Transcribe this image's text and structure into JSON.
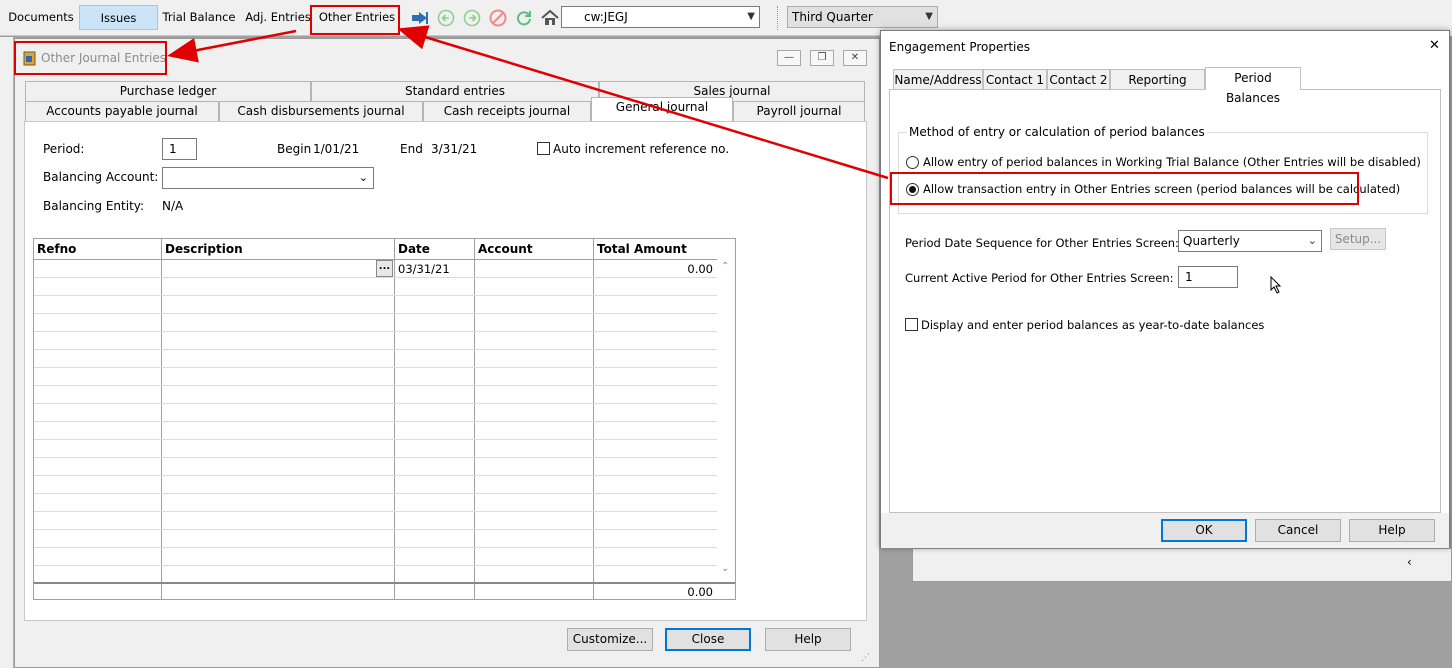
{
  "toolbar": {
    "items": [
      "Documents",
      "Issues",
      "Trial Balance",
      "Adj. Entries",
      "Other Entries"
    ],
    "document_combo": "cw:JEGJ",
    "period_combo": "Third Quarter",
    "colors": {
      "active_tab": "#cce4f7",
      "annotation": "#e00000"
    }
  },
  "oje": {
    "title": "Other Journal Entries",
    "tabs_row1": [
      "Purchase ledger",
      "Standard entries",
      "Sales journal"
    ],
    "tabs_row2": [
      "Accounts payable journal",
      "Cash disbursements journal",
      "Cash receipts journal",
      "General journal",
      "Payroll journal"
    ],
    "period_label": "Period:",
    "period_value": "1",
    "begin_label": "Begin",
    "begin_value": "1/01/21",
    "end_label": "End",
    "end_value": "3/31/21",
    "auto_increment_label": "Auto increment reference no.",
    "balancing_account_label": "Balancing Account:",
    "balancing_entity_label": "Balancing Entity:",
    "balancing_entity_value": "N/A",
    "grid": {
      "columns": [
        "Refno",
        "Description",
        "Date",
        "Account",
        "Total Amount"
      ],
      "row1": {
        "ellipsis": "...",
        "date": "03/31/21",
        "amount": "0.00"
      },
      "total": "0.00"
    },
    "buttons": {
      "customize": "Customize...",
      "close": "Close",
      "help": "Help"
    }
  },
  "ep": {
    "title": "Engagement Properties",
    "close_glyph": "✕",
    "tabs": [
      "Name/Address",
      "Contact 1",
      "Contact 2",
      "Reporting Dates",
      "Period Balances"
    ],
    "group_label": "Method of entry or calculation of period balances",
    "radio1": "Allow entry of period balances in Working Trial Balance (Other Entries will be disabled)",
    "radio2": "Allow transaction entry in Other Entries screen (period balances will be calculated)",
    "sequence_label": "Period Date Sequence for Other Entries Screen:",
    "sequence_value": "Quarterly",
    "setup_label": "Setup...",
    "active_period_label": "Current Active Period for Other Entries Screen:",
    "active_period_value": "1",
    "ytd_label": "Display and enter period balances as year-to-date balances",
    "buttons": {
      "ok": "OK",
      "cancel": "Cancel",
      "help": "Help"
    }
  }
}
